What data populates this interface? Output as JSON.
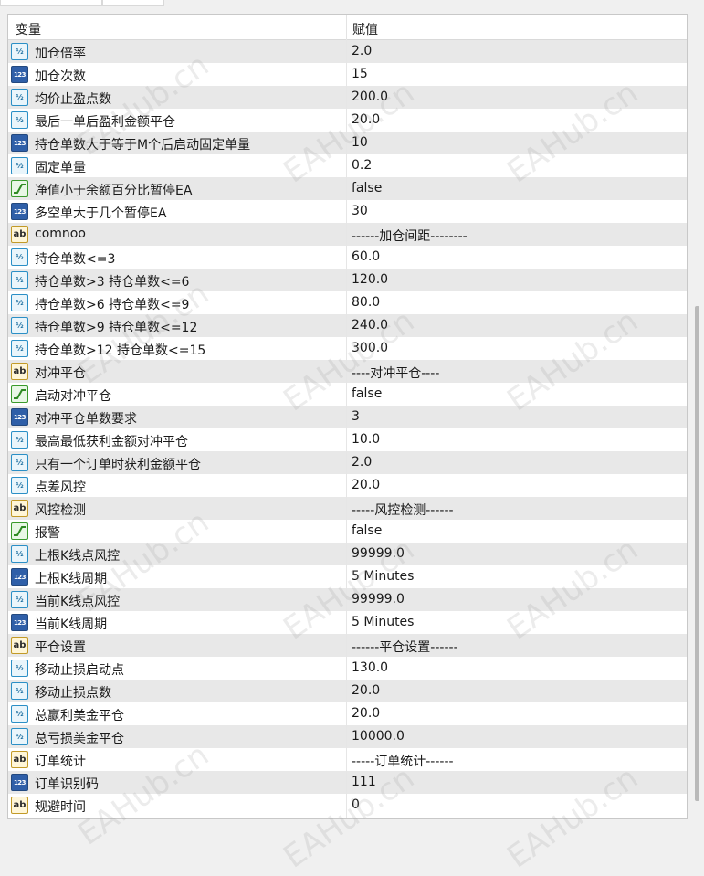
{
  "header": {
    "col_name": "变量",
    "col_value": "赋值"
  },
  "watermark": "EAHub.cn",
  "rows": [
    {
      "icon": "half",
      "name": "加仓倍率",
      "value": "2.0"
    },
    {
      "icon": "num",
      "name": "加仓次数",
      "value": "15"
    },
    {
      "icon": "half",
      "name": "均价止盈点数",
      "value": "200.0"
    },
    {
      "icon": "half",
      "name": "最后一单后盈利金额平仓",
      "value": "20.0"
    },
    {
      "icon": "num",
      "name": "持仓单数大于等于M个后启动固定单量",
      "value": "10"
    },
    {
      "icon": "half",
      "name": "固定单量",
      "value": "0.2"
    },
    {
      "icon": "bool",
      "name": "净值小于余额百分比暂停EA",
      "value": "false"
    },
    {
      "icon": "num",
      "name": "多空单大于几个暂停EA",
      "value": "30"
    },
    {
      "icon": "str",
      "name": "comnoo",
      "value": "------加仓间距--------"
    },
    {
      "icon": "half",
      "name": "持仓单数<=3",
      "value": "60.0"
    },
    {
      "icon": "half",
      "name": "持仓单数>3  持仓单数<=6",
      "value": "120.0"
    },
    {
      "icon": "half",
      "name": "持仓单数>6  持仓单数<=9",
      "value": "80.0"
    },
    {
      "icon": "half",
      "name": "持仓单数>9  持仓单数<=12",
      "value": "240.0"
    },
    {
      "icon": "half",
      "name": "持仓单数>12  持仓单数<=15",
      "value": "300.0"
    },
    {
      "icon": "str",
      "name": "对冲平仓",
      "value": "----对冲平仓----"
    },
    {
      "icon": "bool",
      "name": "启动对冲平仓",
      "value": "false"
    },
    {
      "icon": "num",
      "name": "对冲平仓单数要求",
      "value": "3"
    },
    {
      "icon": "half",
      "name": "最高最低获利金额对冲平仓",
      "value": "10.0"
    },
    {
      "icon": "half",
      "name": "只有一个订单时获利金额平仓",
      "value": "2.0"
    },
    {
      "icon": "half",
      "name": "点差风控",
      "value": "20.0"
    },
    {
      "icon": "str",
      "name": "风控检测",
      "value": "-----风控检测------"
    },
    {
      "icon": "bool",
      "name": "报警",
      "value": "false"
    },
    {
      "icon": "half",
      "name": "上根K线点风控",
      "value": "99999.0"
    },
    {
      "icon": "num",
      "name": "上根K线周期",
      "value": "5 Minutes"
    },
    {
      "icon": "half",
      "name": "当前K线点风控",
      "value": "99999.0"
    },
    {
      "icon": "num",
      "name": "当前K线周期",
      "value": "5 Minutes"
    },
    {
      "icon": "str",
      "name": "平仓设置",
      "value": "------平仓设置------"
    },
    {
      "icon": "half",
      "name": "移动止损启动点",
      "value": "130.0"
    },
    {
      "icon": "half",
      "name": "移动止损点数",
      "value": "20.0"
    },
    {
      "icon": "half",
      "name": "总赢利美金平仓",
      "value": "20.0"
    },
    {
      "icon": "half",
      "name": "总亏损美金平仓",
      "value": "10000.0"
    },
    {
      "icon": "str",
      "name": "订单统计",
      "value": "-----订单统计------"
    },
    {
      "icon": "num",
      "name": "订单识别码",
      "value": "111"
    },
    {
      "icon": "str",
      "name": "规避时间",
      "value": "0"
    }
  ]
}
